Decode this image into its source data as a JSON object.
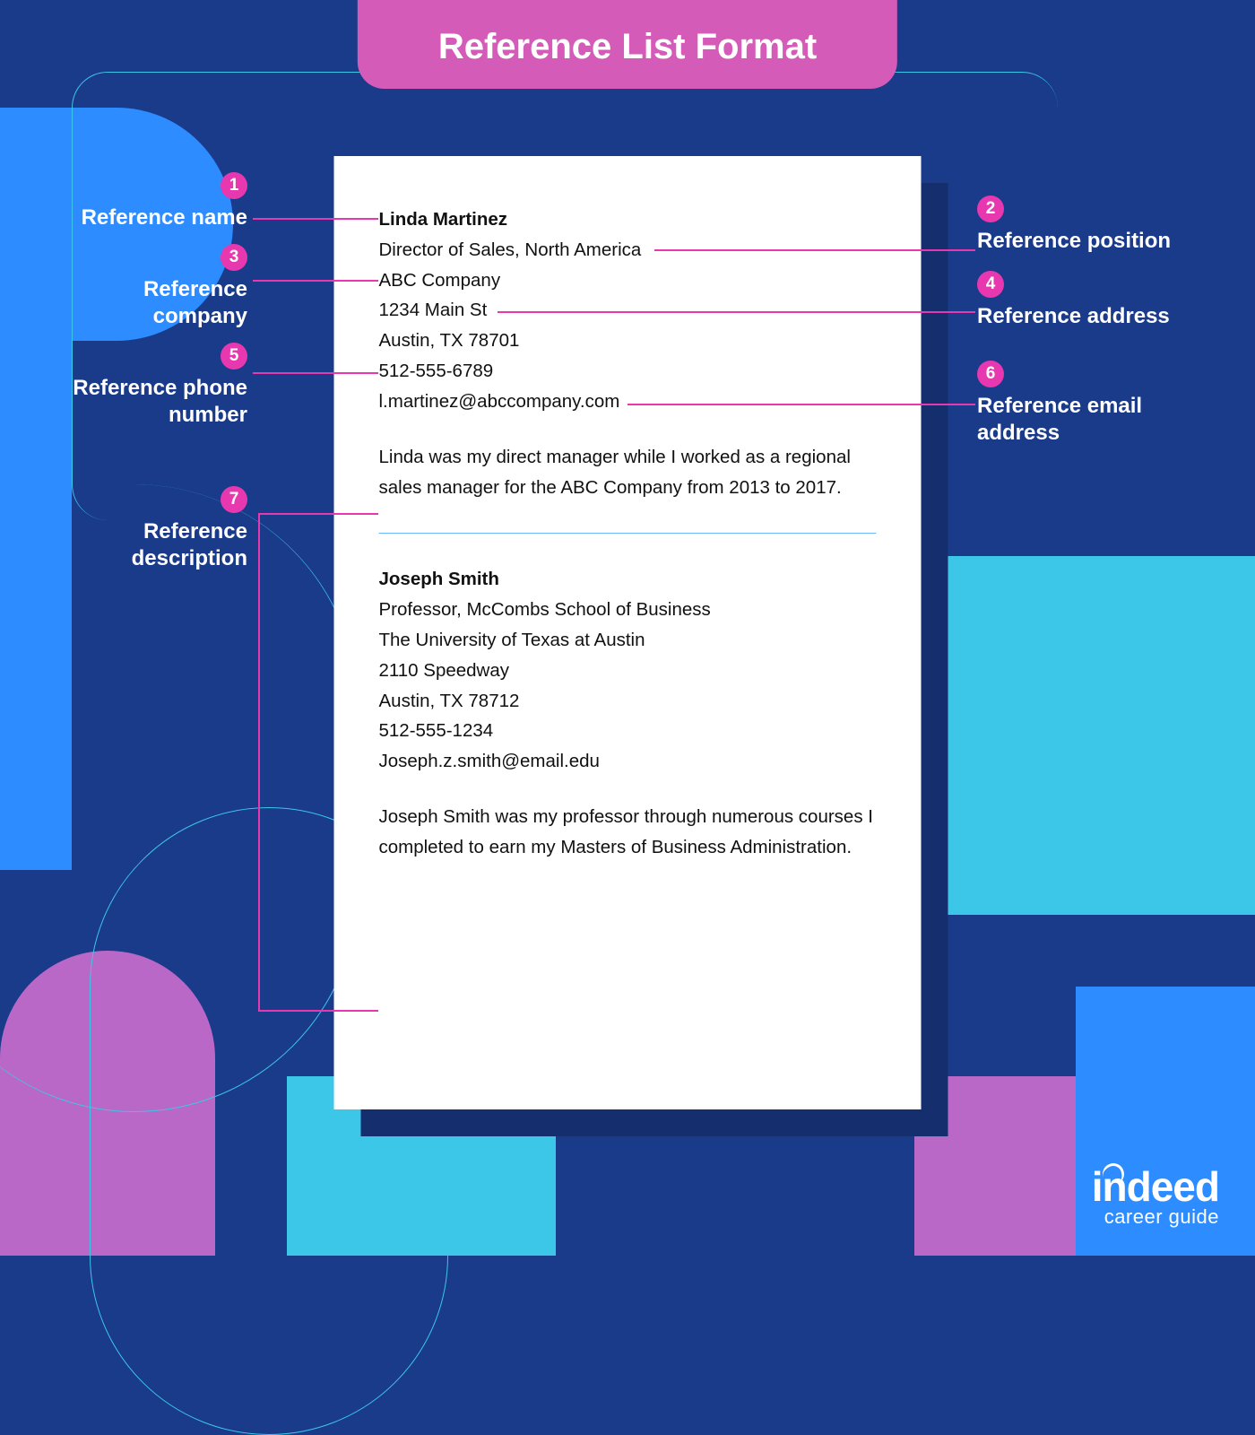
{
  "title": "Reference List Format",
  "callouts": {
    "c1": {
      "num": "1",
      "label": "Reference name"
    },
    "c2": {
      "num": "2",
      "label": "Reference position"
    },
    "c3": {
      "num": "3",
      "label": "Reference\ncompany"
    },
    "c4": {
      "num": "4",
      "label": "Reference address"
    },
    "c5": {
      "num": "5",
      "label": "Reference phone\nnumber"
    },
    "c6": {
      "num": "6",
      "label": "Reference email\naddress"
    },
    "c7": {
      "num": "7",
      "label": "Reference\ndescription"
    }
  },
  "references": [
    {
      "name": "Linda Martinez",
      "position": "Director of Sales, North America",
      "company": "ABC Company",
      "address_line1": "1234 Main St",
      "address_line2": "Austin, TX 78701",
      "phone": "512-555-6789",
      "email": "l.martinez@abccompany.com",
      "description": "Linda was my direct manager while I worked as a regional sales manager for the ABC Company from 2013 to 2017."
    },
    {
      "name": "Joseph Smith",
      "position": "Professor, McCombs School of Business",
      "company": "The University of Texas at Austin",
      "address_line1": "2110 Speedway",
      "address_line2": "Austin, TX 78712",
      "phone": "512-555-1234",
      "email": "Joseph.z.smith@email.edu",
      "description": "Joseph Smith was my professor through numerous courses I completed to earn my Masters of Business Administration."
    }
  ],
  "brand": {
    "name": "indeed",
    "sub": "career guide"
  }
}
